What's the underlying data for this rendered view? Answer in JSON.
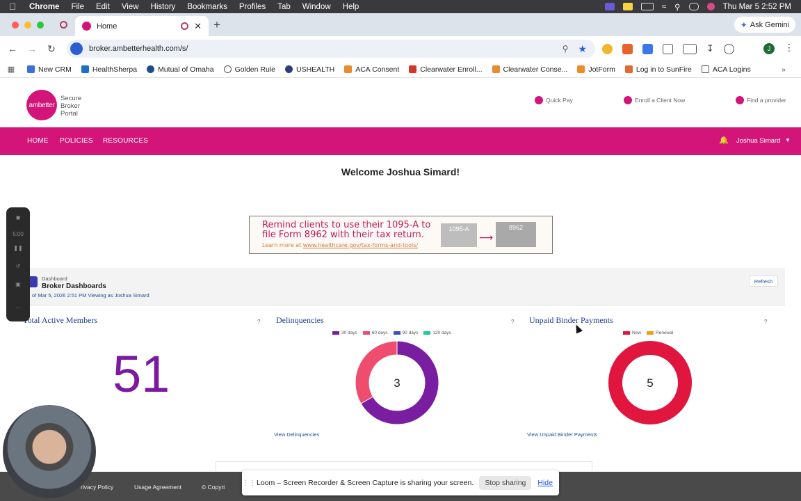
{
  "menubar": {
    "app": "Chrome",
    "items": [
      "File",
      "Edit",
      "View",
      "History",
      "Bookmarks",
      "Profiles",
      "Tab",
      "Window",
      "Help"
    ],
    "clock": "Thu Mar 5  2:52 PM"
  },
  "browser": {
    "tab_title": "Home",
    "gemini_label": "Ask Gemini",
    "url": "broker.ambetterhealth.com/s/",
    "profile_initial": "J"
  },
  "bookmarks": [
    "New CRM",
    "HealthSherpa",
    "Mutual of Omaha",
    "Golden Rule",
    "USHEALTH",
    "ACA Consent",
    "Clearwater Enroll...",
    "Clearwater Conse...",
    "JotForm",
    "Log in to SunFire",
    "ACA Logins"
  ],
  "header": {
    "logo_text": "ambetter",
    "portal_name": "Secure Broker Portal",
    "links": {
      "quick_pay": "Quick Pay",
      "enroll": "Enroll a Client Now",
      "provider": "Find a provider"
    }
  },
  "nav": {
    "items": [
      "HOME",
      "POLICIES",
      "RESOURCES"
    ],
    "user": "Joshua Simard"
  },
  "welcome": "Welcome Joshua Simard!",
  "banner": {
    "line1": "Remind clients to use their 1095-A to",
    "line2": "file Form 8962 with their tax return.",
    "learn_prefix": "Learn more at ",
    "learn_link": "www.healthcare.gov/tax-forms-and-tools/",
    "form_a": "1095-A",
    "form_b": "8962"
  },
  "dashboard": {
    "subtitle": "Dashboard",
    "title": "Broker Dashboards",
    "meta": "of Mar 5, 2026 2:51 PM Viewing as Joshua Simard",
    "refresh": "Refresh"
  },
  "widgets": {
    "members": {
      "title": "Total Active Members",
      "value": "51",
      "help": "?"
    },
    "delinquencies": {
      "title": "Delinquencies",
      "help": "?",
      "total": "3",
      "legend": [
        {
          "label": "30 days",
          "color": "#7a1ea1"
        },
        {
          "label": "60 days",
          "color": "#ee4d6e"
        },
        {
          "label": "90 days",
          "color": "#3f51b5"
        },
        {
          "label": "120 days",
          "color": "#26c6a5"
        }
      ],
      "segments": [
        {
          "label": "30 days",
          "value": 2,
          "color": "#7a1ea1"
        },
        {
          "label": "60 days",
          "value": 1,
          "color": "#ee4d6e"
        }
      ],
      "link": "View Delinquencies"
    },
    "binder": {
      "title": "Unpaid Binder Payments",
      "help": "?",
      "total": "5",
      "legend": [
        {
          "label": "New",
          "color": "#e0163f"
        },
        {
          "label": "Renewal",
          "color": "#f39c12"
        }
      ],
      "segments": [
        {
          "label": "New",
          "value": 5,
          "color": "#e0163f"
        }
      ],
      "link": "View Unpaid Binder Payments"
    }
  },
  "recorder": {
    "timer": "5:00"
  },
  "footer": {
    "privacy": "rivacy Policy",
    "usage": "Usage Agreement",
    "copyright": "© Copyri"
  },
  "loom": {
    "message": "Loom – Screen Recorder & Screen Capture is sharing your screen.",
    "stop": "Stop sharing",
    "hide": "Hide"
  }
}
